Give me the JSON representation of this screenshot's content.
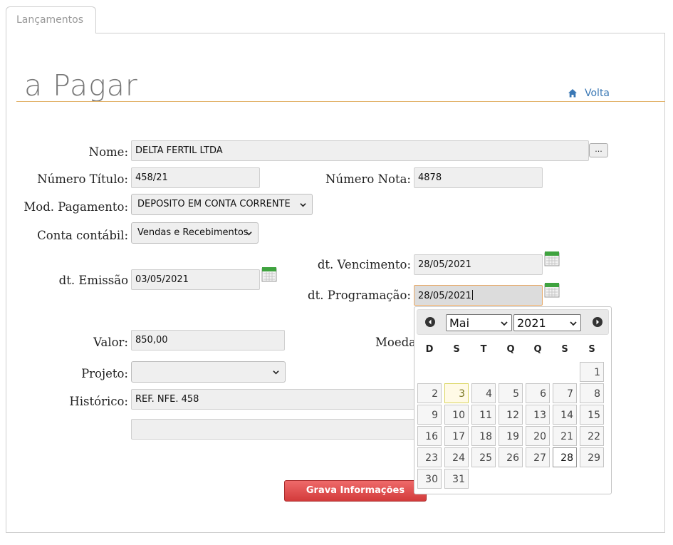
{
  "tab": {
    "label": "Lançamentos"
  },
  "page": {
    "title": "a Pagar",
    "back_label": "Volta"
  },
  "form": {
    "nome": {
      "label": "Nome:",
      "value": "DELTA FERTIL LTDA",
      "lookup_label": "..."
    },
    "numero_titulo": {
      "label": "Número Título:",
      "value": "458/21"
    },
    "numero_nota": {
      "label": "Número Nota:",
      "value": "4878"
    },
    "mod_pagamento": {
      "label": "Mod. Pagamento:",
      "value": "DEPOSITO EM CONTA CORRENTE"
    },
    "conta_contabil": {
      "label": "Conta contábil:",
      "value": "Vendas e Recebimentos"
    },
    "dt_vencimento": {
      "label": "dt. Vencimento:",
      "value": "28/05/2021"
    },
    "dt_emissao": {
      "label": "dt. Emissão",
      "value": "03/05/2021"
    },
    "dt_programacao": {
      "label": "dt. Programação:",
      "value": "28/05/2021"
    },
    "valor": {
      "label": "Valor:",
      "value": "850,00"
    },
    "moeda": {
      "label": "Moeda"
    },
    "projeto": {
      "label": "Projeto:",
      "value": ""
    },
    "historico": {
      "label": "Histórico:",
      "value": "REF. NFE. 458",
      "value2": ""
    },
    "save_label": "Grava Informações"
  },
  "datepicker": {
    "month": "Mai",
    "year": "2021",
    "weekdays": [
      "D",
      "S",
      "T",
      "Q",
      "Q",
      "S",
      "S"
    ],
    "first_weekday_index": 6,
    "days_in_month": 31,
    "today": 3,
    "selected": 28,
    "accent_color": "#dad55e"
  },
  "colors": {
    "title_rule": "#e2b36b",
    "link": "#3a78b5",
    "save_button": "#d33b3b"
  }
}
